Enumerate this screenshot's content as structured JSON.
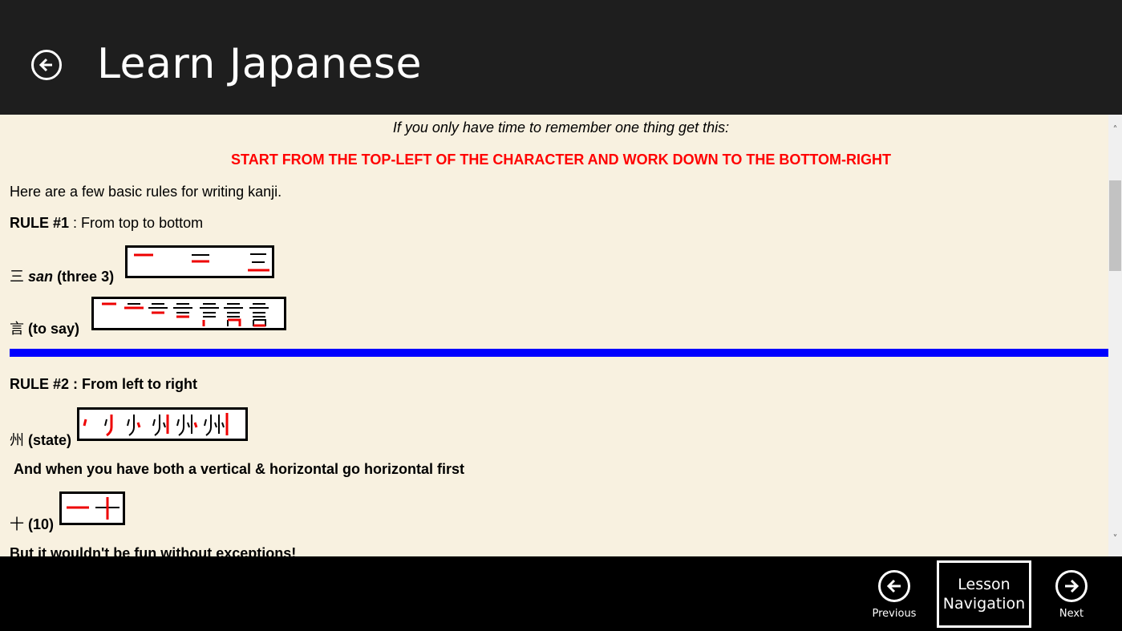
{
  "app": {
    "title": "Learn Japanese"
  },
  "lesson": {
    "intro": "If you only have time to remember one thing get this:",
    "key_rule": "START FROM THE TOP-LEFT OF THE CHARACTER AND WORK DOWN TO THE BOTTOM-RIGHT",
    "basic_rules_intro": "Here are a few basic rules for writing kanji.",
    "rule1_label": "RULE #1",
    "rule1_text": " : From top to bottom",
    "ex1_kanji": "三",
    "ex1_romaji": "san",
    "ex1_meaning": "(three 3)",
    "ex2_kanji": "言",
    "ex2_meaning": "(to say)",
    "rule2_label": "RULE #2",
    "rule2_text": " : From left to right",
    "ex3_kanji": "州",
    "ex3_meaning": "(state)",
    "vh_note": "And when you have both a vertical & horizontal go horizontal first",
    "ex4_kanji": "十",
    "ex4_meaning": "(10)",
    "exceptions": "But it wouldn't be fun without exceptions!"
  },
  "footer": {
    "previous_label": "Previous",
    "lesson_nav_line1": "Lesson",
    "lesson_nav_line2": "Navigation",
    "next_label": "Next"
  },
  "colors": {
    "header_bg": "#1e1e1e",
    "content_bg": "#f8f1e0",
    "accent_red": "#ff0000",
    "divider_blue": "#0000ff"
  },
  "icons": {
    "back": "back-arrow-icon",
    "previous": "previous-arrow-icon",
    "next": "next-arrow-icon"
  }
}
